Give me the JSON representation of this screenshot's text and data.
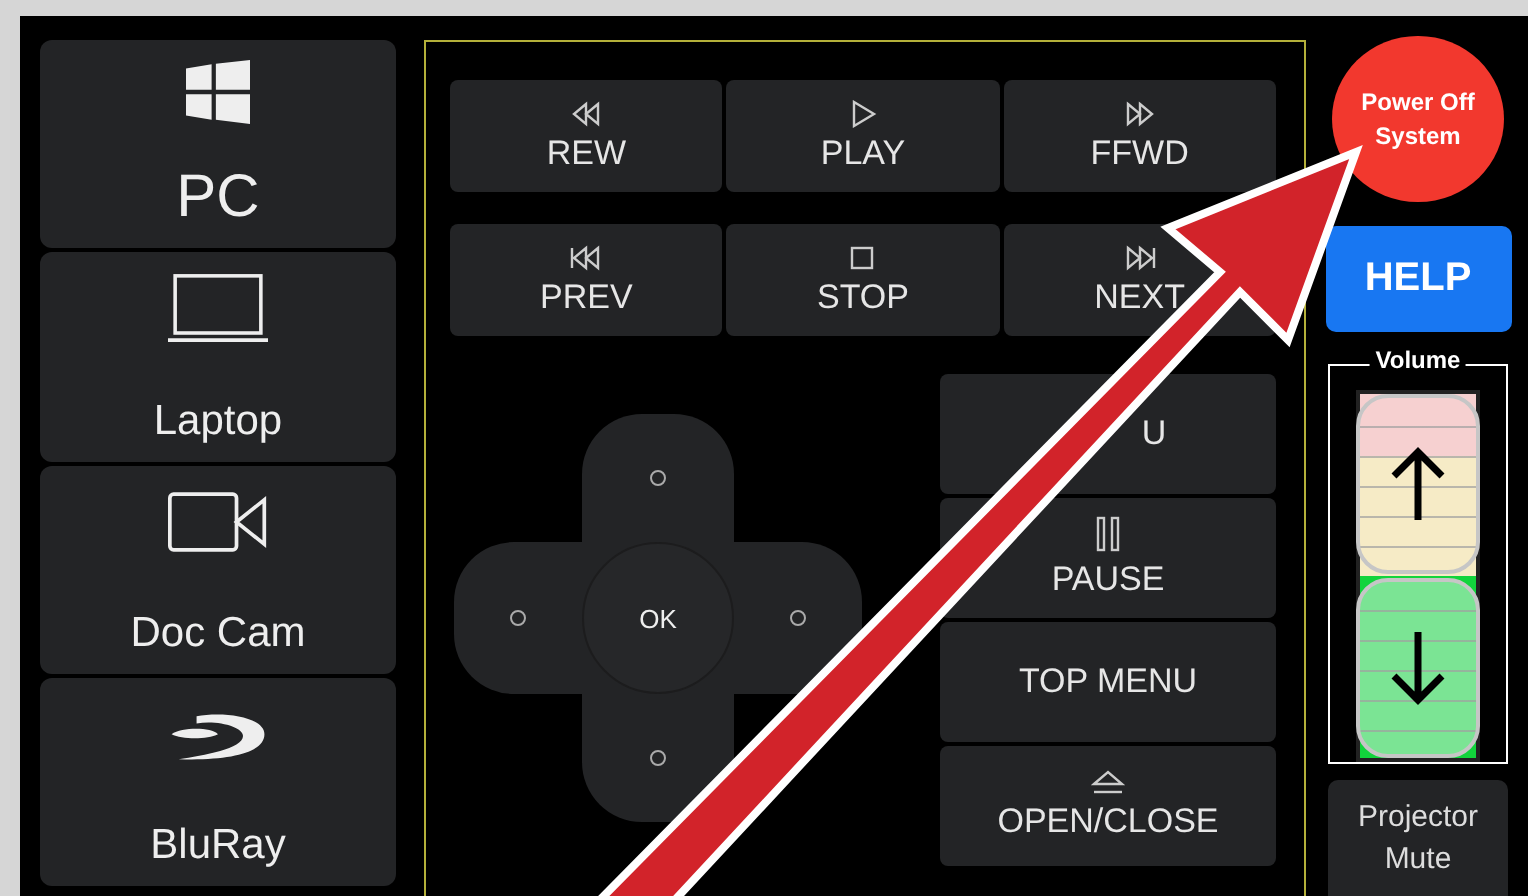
{
  "sources": [
    {
      "label": "PC",
      "kind": "windows"
    },
    {
      "label": "Laptop",
      "kind": "laptop"
    },
    {
      "label": "Doc Cam",
      "kind": "camera"
    },
    {
      "label": "BluRay",
      "kind": "disc"
    }
  ],
  "transport": [
    {
      "label": "REW",
      "kind": "rew"
    },
    {
      "label": "PLAY",
      "kind": "play"
    },
    {
      "label": "FFWD",
      "kind": "ffwd"
    },
    {
      "label": "PREV",
      "kind": "prev"
    },
    {
      "label": "STOP",
      "kind": "stop"
    },
    {
      "label": "NEXT",
      "kind": "next"
    }
  ],
  "dpad": {
    "label": "OK"
  },
  "menu_buttons": [
    {
      "label": "U",
      "kind": "none"
    },
    {
      "label": "PAUSE",
      "kind": "pause"
    },
    {
      "label": "TOP MENU",
      "kind": "none"
    },
    {
      "label": "OPEN/CLOSE",
      "kind": "eject"
    }
  ],
  "power_button": {
    "label": "Power Off System"
  },
  "help_button": {
    "label": "HELP"
  },
  "volume": {
    "title": "Volume",
    "level": 0.5
  },
  "projector_mute": {
    "label": "Projector Mute"
  }
}
